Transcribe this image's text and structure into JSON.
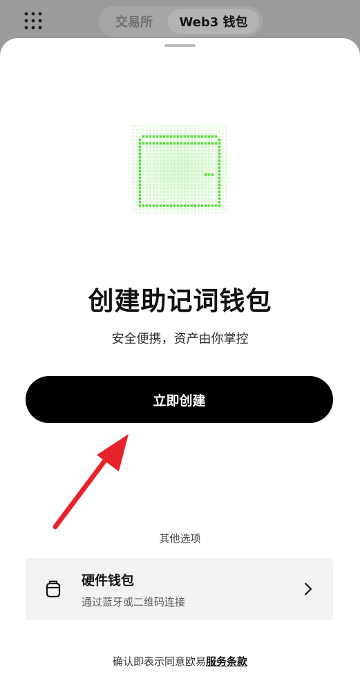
{
  "header": {
    "tabs": [
      {
        "label": "交易所",
        "active": false
      },
      {
        "label": "Web3 钱包",
        "active": true
      }
    ],
    "apps_icon": "grid-dots-icon"
  },
  "hero": {
    "icon": "wallet-icon",
    "accent_color": "#57d93a",
    "title": "创建助记词钱包",
    "subtitle": "安全便携，资产由你掌控"
  },
  "primary_action": {
    "label": "立即创建"
  },
  "annotation": {
    "icon": "red-arrow-icon",
    "color": "#e8222b"
  },
  "other_options": {
    "label": "其他选项",
    "items": [
      {
        "icon": "hardware-wallet-icon",
        "title": "硬件钱包",
        "description": "通过蓝牙或二维码连接"
      }
    ]
  },
  "footer": {
    "text": "确认即表示同意欧易",
    "link_label": "服务条款"
  }
}
